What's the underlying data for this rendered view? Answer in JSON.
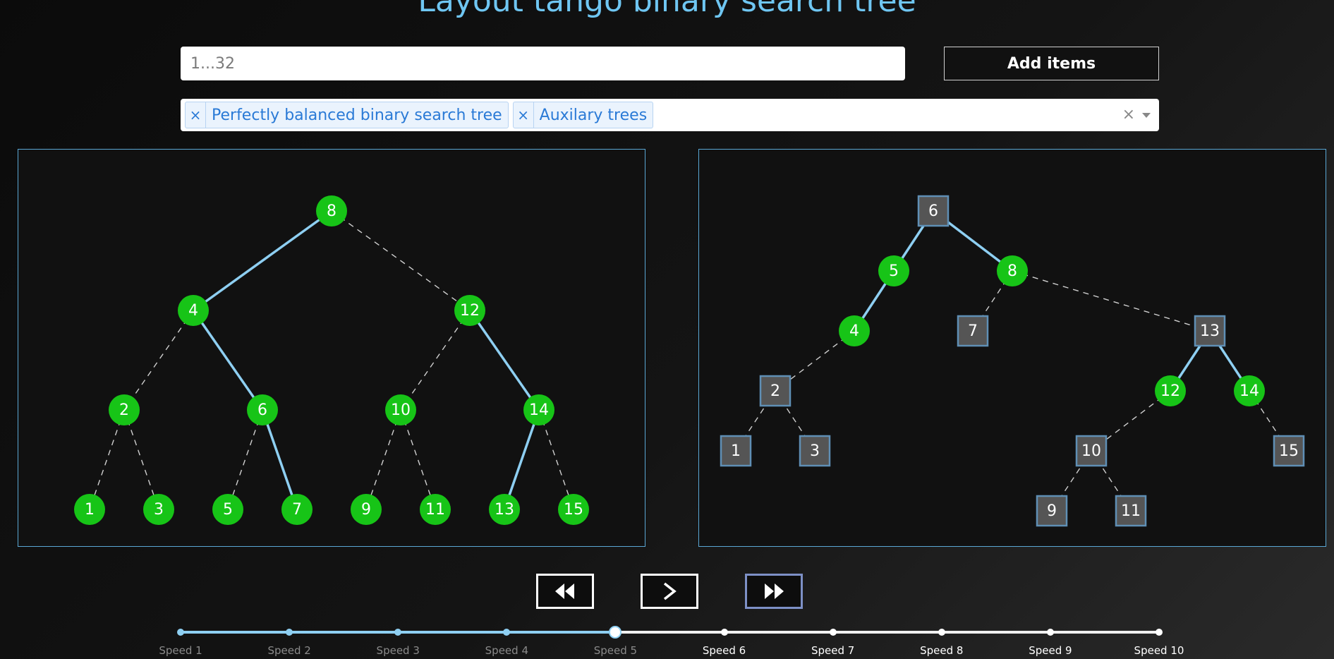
{
  "title": "Layout tango binary search tree",
  "input": {
    "placeholder": "1...32",
    "value": ""
  },
  "add_button_label": "Add items",
  "selected_options": [
    {
      "label": "Perfectly balanced binary search tree"
    },
    {
      "label": "Auxilary trees"
    }
  ],
  "clear_glyph": "×",
  "tag_remove_glyph": "×",
  "colors": {
    "accent": "#6fc6f2",
    "node_green": "#17c417",
    "node_square": "#555555",
    "node_square_border": "#5f8fb5",
    "preferred_edge": "#8ecff2",
    "dashed_edge": "#d0d0d0",
    "panel_border": "#5aa7d4"
  },
  "left_tree": {
    "nodes": [
      {
        "label": "8",
        "shape": "circle"
      },
      {
        "label": "4",
        "shape": "circle"
      },
      {
        "label": "12",
        "shape": "circle"
      },
      {
        "label": "2",
        "shape": "circle"
      },
      {
        "label": "6",
        "shape": "circle"
      },
      {
        "label": "10",
        "shape": "circle"
      },
      {
        "label": "14",
        "shape": "circle"
      },
      {
        "label": "1",
        "shape": "circle"
      },
      {
        "label": "3",
        "shape": "circle"
      },
      {
        "label": "5",
        "shape": "circle"
      },
      {
        "label": "7",
        "shape": "circle"
      },
      {
        "label": "9",
        "shape": "circle"
      },
      {
        "label": "11",
        "shape": "circle"
      },
      {
        "label": "13",
        "shape": "circle"
      },
      {
        "label": "15",
        "shape": "circle"
      }
    ],
    "edges": [
      {
        "from": "8",
        "to": "4",
        "style": "solid"
      },
      {
        "from": "8",
        "to": "12",
        "style": "dashed"
      },
      {
        "from": "4",
        "to": "2",
        "style": "dashed"
      },
      {
        "from": "4",
        "to": "6",
        "style": "solid"
      },
      {
        "from": "12",
        "to": "10",
        "style": "dashed"
      },
      {
        "from": "12",
        "to": "14",
        "style": "solid"
      },
      {
        "from": "2",
        "to": "1",
        "style": "dashed"
      },
      {
        "from": "2",
        "to": "3",
        "style": "dashed"
      },
      {
        "from": "6",
        "to": "5",
        "style": "dashed"
      },
      {
        "from": "6",
        "to": "7",
        "style": "solid"
      },
      {
        "from": "10",
        "to": "9",
        "style": "dashed"
      },
      {
        "from": "10",
        "to": "11",
        "style": "dashed"
      },
      {
        "from": "14",
        "to": "13",
        "style": "solid"
      },
      {
        "from": "14",
        "to": "15",
        "style": "dashed"
      }
    ]
  },
  "right_tree": {
    "nodes": [
      {
        "label": "6",
        "shape": "square"
      },
      {
        "label": "5",
        "shape": "circle"
      },
      {
        "label": "8",
        "shape": "circle"
      },
      {
        "label": "4",
        "shape": "circle"
      },
      {
        "label": "7",
        "shape": "square"
      },
      {
        "label": "13",
        "shape": "square"
      },
      {
        "label": "2",
        "shape": "square"
      },
      {
        "label": "12",
        "shape": "circle"
      },
      {
        "label": "14",
        "shape": "circle"
      },
      {
        "label": "1",
        "shape": "square"
      },
      {
        "label": "3",
        "shape": "square"
      },
      {
        "label": "10",
        "shape": "square"
      },
      {
        "label": "15",
        "shape": "square"
      },
      {
        "label": "9",
        "shape": "square"
      },
      {
        "label": "11",
        "shape": "square"
      }
    ],
    "edges": [
      {
        "from": "6",
        "to": "5",
        "style": "solid"
      },
      {
        "from": "6",
        "to": "8",
        "style": "solid"
      },
      {
        "from": "5",
        "to": "4",
        "style": "solid"
      },
      {
        "from": "8",
        "to": "7",
        "style": "dashed"
      },
      {
        "from": "8",
        "to": "13",
        "style": "dashed"
      },
      {
        "from": "4",
        "to": "2",
        "style": "dashed"
      },
      {
        "from": "13",
        "to": "12",
        "style": "solid"
      },
      {
        "from": "13",
        "to": "14",
        "style": "solid"
      },
      {
        "from": "2",
        "to": "1",
        "style": "dashed"
      },
      {
        "from": "2",
        "to": "3",
        "style": "dashed"
      },
      {
        "from": "12",
        "to": "10",
        "style": "dashed"
      },
      {
        "from": "14",
        "to": "15",
        "style": "dashed"
      },
      {
        "from": "10",
        "to": "9",
        "style": "dashed"
      },
      {
        "from": "10",
        "to": "11",
        "style": "dashed"
      }
    ]
  },
  "controls": [
    {
      "name": "rewind-button",
      "icon": "double-chevron-left-icon"
    },
    {
      "name": "step-forward-button",
      "icon": "chevron-right-icon"
    },
    {
      "name": "fast-forward-button",
      "icon": "double-chevron-right-icon",
      "active": true
    }
  ],
  "speed": {
    "labels": [
      "Speed 1",
      "Speed 2",
      "Speed 3",
      "Speed 4",
      "Speed 5",
      "Speed 6",
      "Speed 7",
      "Speed 8",
      "Speed 9",
      "Speed 10"
    ],
    "selected_index": 4
  }
}
